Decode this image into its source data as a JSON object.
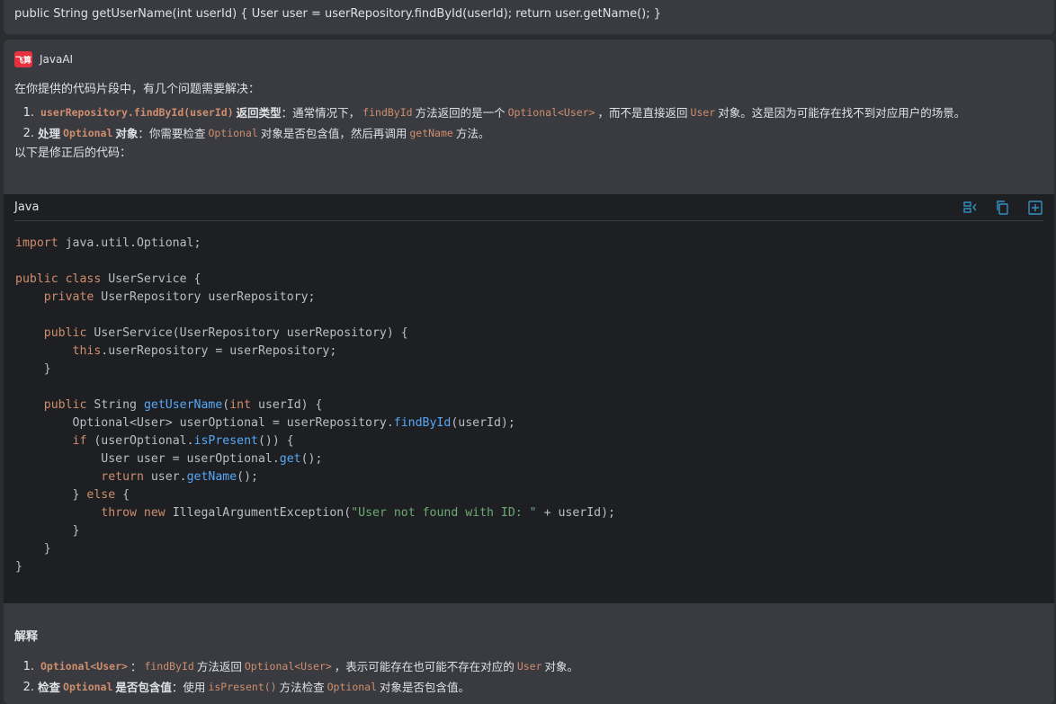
{
  "user_message": "public String getUserName(int userId) { User user = userRepository.findById(userId); return user.getName(); }",
  "ai": {
    "name": "JavaAI",
    "logo_text": "飞算",
    "intro": "在你提供的代码片段中，有几个问题需要解决：",
    "issues": [
      {
        "num": "1.",
        "code1": "userRepository.findById(userId)",
        "title": "返回类型",
        "t1": "：通常情况下，",
        "c2": "findById",
        "t2": "方法返回的是一个",
        "c3": "Optional<User>",
        "t3": "，而不是直接返回",
        "c4": "User",
        "t4": "对象。这是因为可能存在找不到对应用户的场景。"
      },
      {
        "num": "2.",
        "title_a": "处理",
        "code1": "Optional",
        "title_b": "对象",
        "t1": "：你需要检查",
        "c2": "Optional",
        "t2": "对象是否包含值，然后再调用",
        "c3": "getName",
        "t3": "方法。"
      }
    ],
    "after": "以下是修正后的代码："
  },
  "code_block": {
    "language": "Java",
    "icons": [
      "insert-icon",
      "copy-icon",
      "new-file-icon"
    ]
  },
  "explain": {
    "title": "解释",
    "items": [
      {
        "num": "1.",
        "code1": "Optional<User>",
        "t1": "：",
        "c2": "findById",
        "t2": "方法返回",
        "c3": "Optional<User>",
        "t3": "，表示可能存在也可能不存在对应的",
        "c4": "User",
        "t4": "对象。"
      },
      {
        "num": "2.",
        "title_a": "检查",
        "code1": "Optional",
        "title_b": "是否包含值",
        "t1": "：使用",
        "c2": "isPresent()",
        "t2": "方法检查",
        "c3": "Optional",
        "t3": "对象是否包含值。"
      }
    ]
  },
  "colors": {
    "keyword": "#cf8e6d",
    "function": "#56a8f5",
    "string": "#6aab73",
    "accent": "#3592c4"
  }
}
